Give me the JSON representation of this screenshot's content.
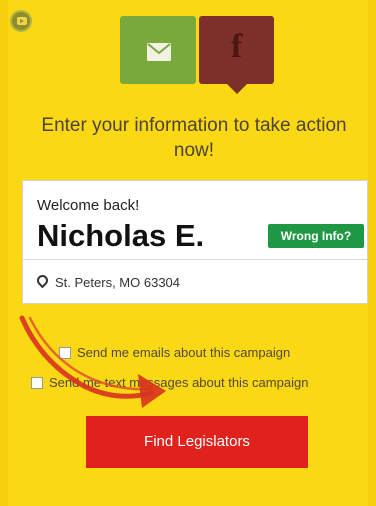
{
  "share": {
    "email_icon": "envelope-icon",
    "facebook_icon": "facebook-icon",
    "facebook_glyph": "f"
  },
  "headline": "Enter your information to take action now!",
  "card": {
    "welcome": "Welcome back!",
    "name": "Nicholas E.",
    "wrong_info_label": "Wrong Info?",
    "address": "St. Peters, MO 63304"
  },
  "options": {
    "emails_label": "Send me emails about this campaign",
    "texts_label": "Send me text messages about this campaign"
  },
  "cta": {
    "label": "Find Legislators"
  },
  "colors": {
    "background": "#fbd814",
    "email": "#79a93b",
    "facebook": "#7d2f29",
    "wrong_info": "#1f9846",
    "cta": "#e1221c",
    "annotation_arrow": "#d9321f"
  }
}
